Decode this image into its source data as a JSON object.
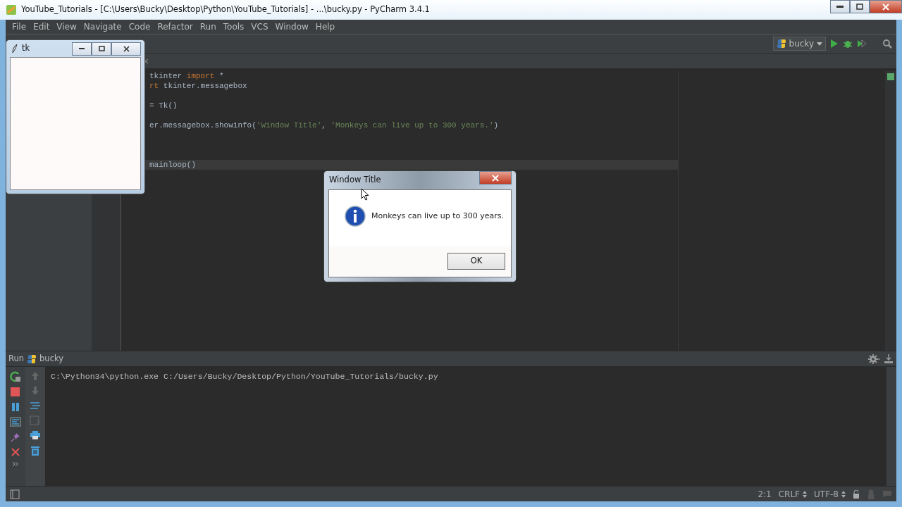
{
  "window": {
    "title": "YouTube_Tutorials - [C:\\Users\\Bucky\\Desktop\\Python\\YouTube_Tutorials] - ...\\bucky.py - PyCharm 3.4.1"
  },
  "menu": [
    {
      "label": "File"
    },
    {
      "label": "Edit"
    },
    {
      "label": "View"
    },
    {
      "label": "Navigate"
    },
    {
      "label": "Code"
    },
    {
      "label": "Refactor"
    },
    {
      "label": "Run"
    },
    {
      "label": "Tools"
    },
    {
      "label": "VCS"
    },
    {
      "label": "Window"
    },
    {
      "label": "Help"
    }
  ],
  "toolbar": {
    "run_config": "bucky"
  },
  "editor": {
    "lines": [
      {
        "current": false,
        "tokens": [
          {
            "text": "tkinter ",
            "kind": "plain"
          },
          {
            "text": "import",
            "kind": "keyword"
          },
          {
            "text": " *",
            "kind": "plain"
          }
        ]
      },
      {
        "current": false,
        "tokens": [
          {
            "text": "rt",
            "kind": "keyword"
          },
          {
            "text": " tkinter.messagebox",
            "kind": "plain"
          }
        ]
      },
      {
        "current": false
      },
      {
        "current": false,
        "tokens": [
          {
            "text": "= Tk()",
            "kind": "plain"
          }
        ]
      },
      {
        "current": false
      },
      {
        "current": false,
        "tokens": [
          {
            "text": "er.messagebox.showinfo(",
            "kind": "plain"
          },
          {
            "text": "'Window Title'",
            "kind": "string"
          },
          {
            "text": ", ",
            "kind": "plain"
          },
          {
            "text": "'Monkeys can live up to 300 years.'",
            "kind": "string"
          },
          {
            "text": ")",
            "kind": "plain"
          }
        ]
      },
      {
        "current": false
      },
      {
        "current": false
      },
      {
        "current": false
      },
      {
        "current": true,
        "tokens": [
          {
            "text": "mainloop()",
            "kind": "plain"
          }
        ]
      }
    ]
  },
  "tk_window": {
    "title": "tk"
  },
  "messagebox": {
    "title": "Window Title",
    "message": "Monkeys can live up to 300 years.",
    "button": "OK"
  },
  "run_panel": {
    "label": "Run",
    "config": "bucky",
    "output": [
      "C:\\Python34\\python.exe C:/Users/Bucky/Desktop/Python/YouTube_Tutorials/bucky.py"
    ]
  },
  "status_bar": {
    "position": "2:1",
    "line_separator": "CRLF",
    "encoding": "UTF-8"
  }
}
